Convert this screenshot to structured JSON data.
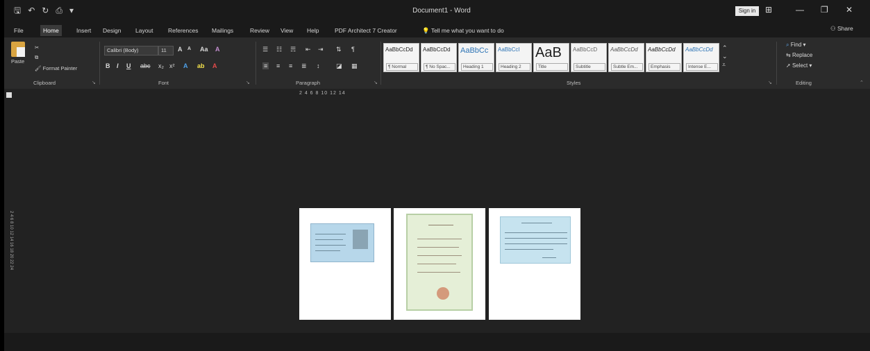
{
  "window": {
    "title": "Document1 - Word",
    "sign_in": "Sign in",
    "share": "Share"
  },
  "tabs": [
    "File",
    "Home",
    "Insert",
    "Design",
    "Layout",
    "References",
    "Mailings",
    "Review",
    "View",
    "Help",
    "PDF Architect 7 Creator"
  ],
  "tell_me": "Tell me what you want to do",
  "clipboard": {
    "paste": "Paste",
    "format_painter": "Format Painter",
    "label": "Clipboard"
  },
  "font": {
    "name": "Calibri (Body)",
    "size": "11",
    "label": "Font"
  },
  "paragraph": {
    "label": "Paragraph"
  },
  "styles": {
    "label": "Styles",
    "items": [
      {
        "preview": "AaBbCcDd",
        "name": "¶ Normal"
      },
      {
        "preview": "AaBbCcDd",
        "name": "¶ No Spac..."
      },
      {
        "preview": "AaBbCc",
        "name": "Heading 1"
      },
      {
        "preview": "AaBbCcI",
        "name": "Heading 2"
      },
      {
        "preview": "AaB",
        "name": "Title"
      },
      {
        "preview": "AaBbCcD",
        "name": "Subtitle"
      },
      {
        "preview": "AaBbCcDd",
        "name": "Subtle Em..."
      },
      {
        "preview": "AaBbCcDd",
        "name": "Emphasis"
      },
      {
        "preview": "AaBbCcDd",
        "name": "Intense E..."
      }
    ]
  },
  "editing": {
    "find": "Find",
    "replace": "Replace",
    "select": "Select",
    "label": "Editing"
  },
  "ruler": {
    "top": "2 4 6 8 10 12 14",
    "side": "2 4 6 8 10 12 14 16 18 20 22 24"
  },
  "colors": {
    "background": "#1f1f1f",
    "ribbon": "#2b2b2b",
    "titlebar": "#1a1a1a"
  }
}
